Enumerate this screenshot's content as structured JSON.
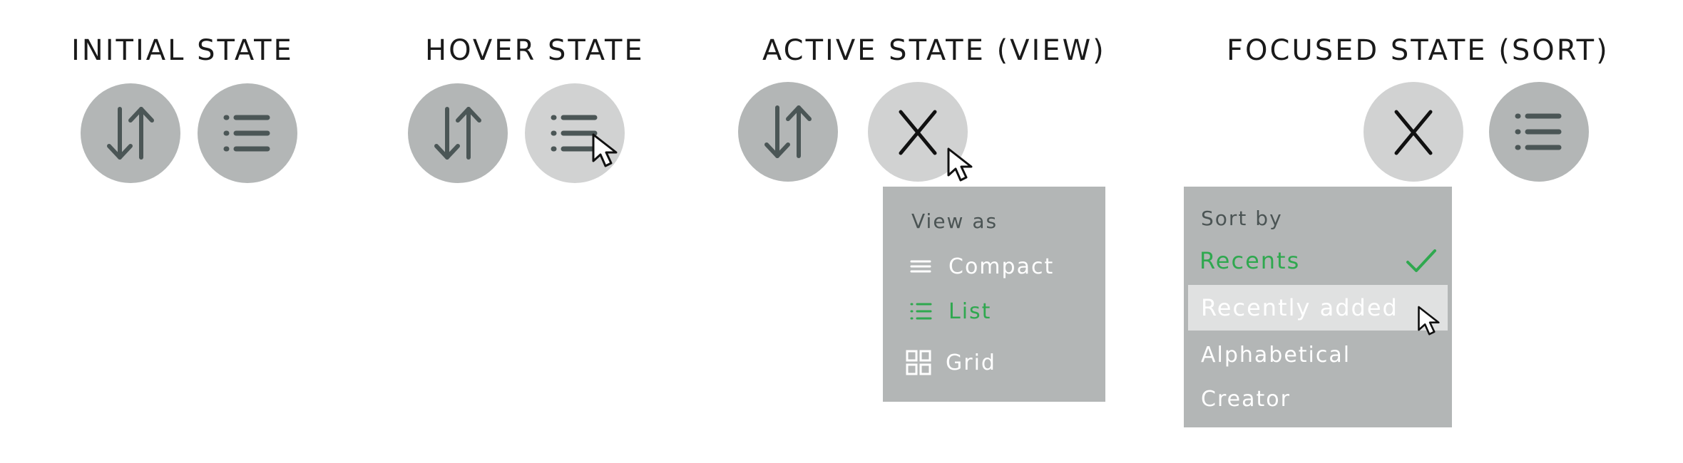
{
  "sections": {
    "initial": {
      "title": "INITIAL  STATE"
    },
    "hover": {
      "title": "HOVER STATE"
    },
    "active": {
      "title": "ACTIVE STATE (VIEW)"
    },
    "focused": {
      "title": "FOCUSED   STATE (SORT)"
    }
  },
  "view_menu": {
    "header": "View  as",
    "items": [
      {
        "label": "Compact",
        "icon": "compact-lines-icon"
      },
      {
        "label": "List",
        "icon": "list-icon",
        "selected": true
      },
      {
        "label": "Grid",
        "icon": "grid-icon"
      }
    ]
  },
  "sort_menu": {
    "header": "Sort by",
    "items": [
      {
        "label": "Recents",
        "selected": true,
        "icon": "checkmark-icon"
      },
      {
        "label": "Recently added",
        "hovered": true
      },
      {
        "label": "Alphabetical"
      },
      {
        "label": "Creator"
      }
    ]
  },
  "colors": {
    "button_default": "#b3b6b6",
    "button_hover": "#d1d2d2",
    "icon_stroke": "#4b5656",
    "selected_text": "#2fa84f",
    "menu_bg": "#b3b6b6",
    "menu_hover_row": "#e0e1e1"
  }
}
